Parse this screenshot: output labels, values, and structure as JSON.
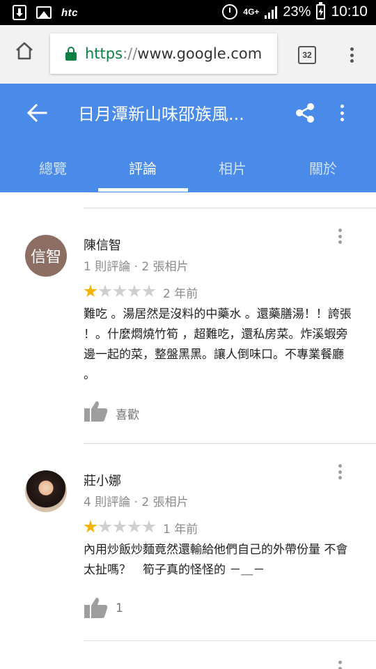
{
  "status_bar": {
    "brand": "htc",
    "network": "4G+",
    "battery": "23%",
    "time": "10:10"
  },
  "browser": {
    "url_scheme": "https",
    "url_sep": "://",
    "url_host": "www.google.com",
    "tab_count": "32"
  },
  "header": {
    "title": "日月潭新山味邵族風..."
  },
  "tabs": [
    {
      "label": "總覽"
    },
    {
      "label": "評論"
    },
    {
      "label": "相片"
    },
    {
      "label": "關於"
    }
  ],
  "reviews": [
    {
      "avatar_text": "信智",
      "name": "陳信智",
      "meta": "1 則評論 · 2 張相片",
      "rating": 1,
      "time": "2 年前",
      "text": "難吃 。湯居然是沒料的中藥水 。還藥膳湯！！誇張 ！。什麼燜燒竹筍 ，超難吃，還私房菜。炸溪蝦旁邊一起的菜，整盤黑黑。讓人倒味口。不專業餐廳 。",
      "like_label": "喜歡"
    },
    {
      "avatar_text": "",
      "name": "莊小娜",
      "meta": "4 則評論 · 2 張相片",
      "rating": 1,
      "time": "1 年前",
      "text": "內用炒飯炒麵竟然還輸給他們自己的外帶份量 不會太扯嗎？　筍子真的怪怪的 －＿－",
      "like_label": "1"
    }
  ],
  "colors": {
    "primary": "#4a8be9",
    "star": "#f4b400",
    "secure": "#0b8043"
  }
}
